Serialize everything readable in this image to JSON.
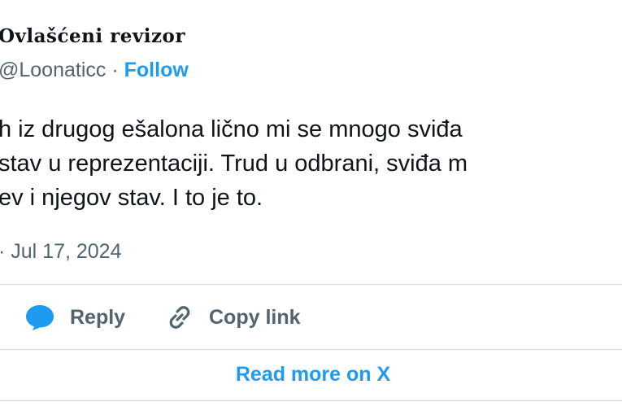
{
  "author": {
    "display_name": "Ovlašćeni revizor",
    "handle": "@Loonaticc",
    "separator": "·",
    "follow_label": "Follow"
  },
  "tweet": {
    "lines": [
      "h iz drugog ešalona lično mi se mnogo sviđa",
      " stav u reprezentaciji. Trud u odbrani, sviđa m",
      "ev i njegov stav. I to je to."
    ],
    "timestamp": "· Jul 17, 2024"
  },
  "actions": {
    "reply_label": "Reply",
    "copy_link_label": "Copy link"
  },
  "footer": {
    "read_more_label": "Read more on X"
  },
  "colors": {
    "accent": "#1d9bf0",
    "text": "#0f1419",
    "secondary": "#536471",
    "divider": "#cfd9de"
  }
}
